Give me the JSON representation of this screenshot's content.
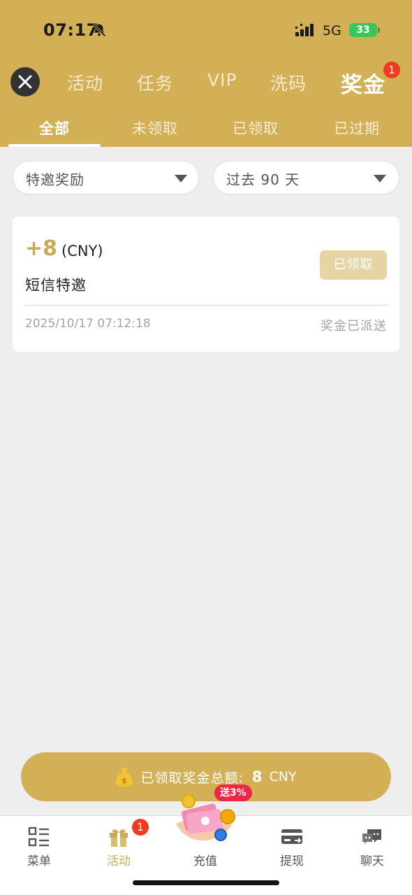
{
  "status_bar": {
    "time": "07:17",
    "network": "5G",
    "battery": "33"
  },
  "header": {
    "tabs": [
      {
        "label": "活动"
      },
      {
        "label": "任务"
      },
      {
        "label": "VIP"
      },
      {
        "label": "洗码"
      },
      {
        "label": "奖金",
        "active": true,
        "badge": "1"
      }
    ],
    "sub_tabs": [
      {
        "label": "全部",
        "active": true
      },
      {
        "label": "未领取"
      },
      {
        "label": "已领取"
      },
      {
        "label": "已过期"
      }
    ]
  },
  "filters": {
    "type": {
      "value": "特邀奖励"
    },
    "period": {
      "value": "过去 90 天"
    }
  },
  "records": [
    {
      "amount": "+8",
      "currency": "(CNY)",
      "name": "短信特邀",
      "button_label": "已领取",
      "datetime": "2025/10/17 07:12:18",
      "status": "奖金已派送"
    }
  ],
  "summary": {
    "label": "已领取奖金总额:",
    "value": "8",
    "currency": "CNY"
  },
  "bottom_nav": [
    {
      "label": "菜单",
      "icon": "menu-icon"
    },
    {
      "label": "活动",
      "icon": "gift-icon",
      "active": true,
      "badge": "1"
    },
    {
      "label": "充值",
      "icon": "deposit-icon",
      "promo": "送3%"
    },
    {
      "label": "提现",
      "icon": "withdraw-card-icon"
    },
    {
      "label": "聊天",
      "icon": "chat-icon"
    }
  ],
  "colors": {
    "brand_gold": "#d3b055",
    "amount_gold": "#c9aa55",
    "badge_red": "#ee3b22",
    "promo_red": "#f0254a"
  }
}
